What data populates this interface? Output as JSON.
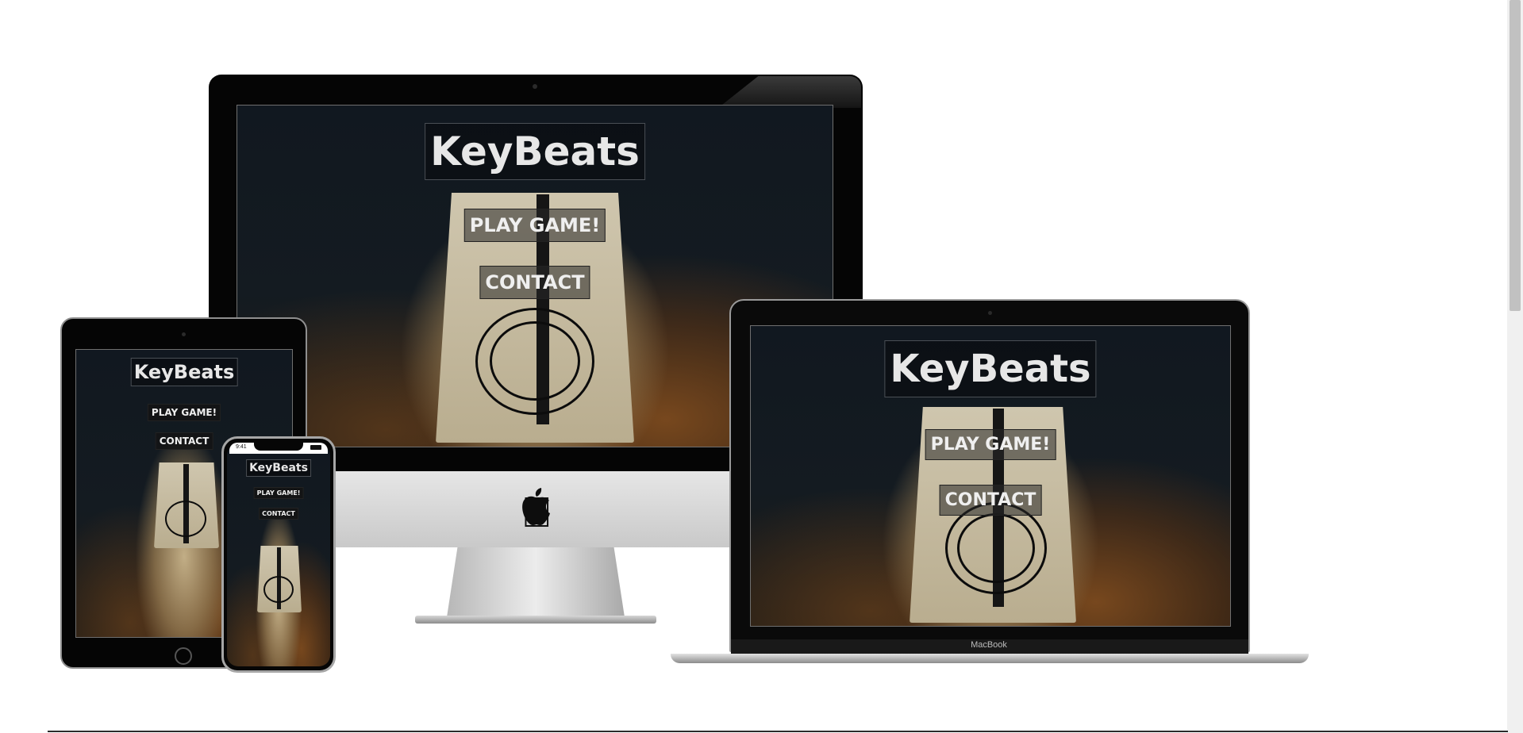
{
  "site": {
    "title": "KeyBeats",
    "buttons": {
      "play": "PLAY GAME!",
      "contact": "CONTACT"
    }
  },
  "devices": {
    "laptop_label": "MacBook",
    "phone_time": "9:41"
  },
  "colors": {
    "screen_bg": "#111820",
    "text": "#e7e7e7",
    "device_frame": "#050505",
    "page_bg": "#ffffff"
  }
}
